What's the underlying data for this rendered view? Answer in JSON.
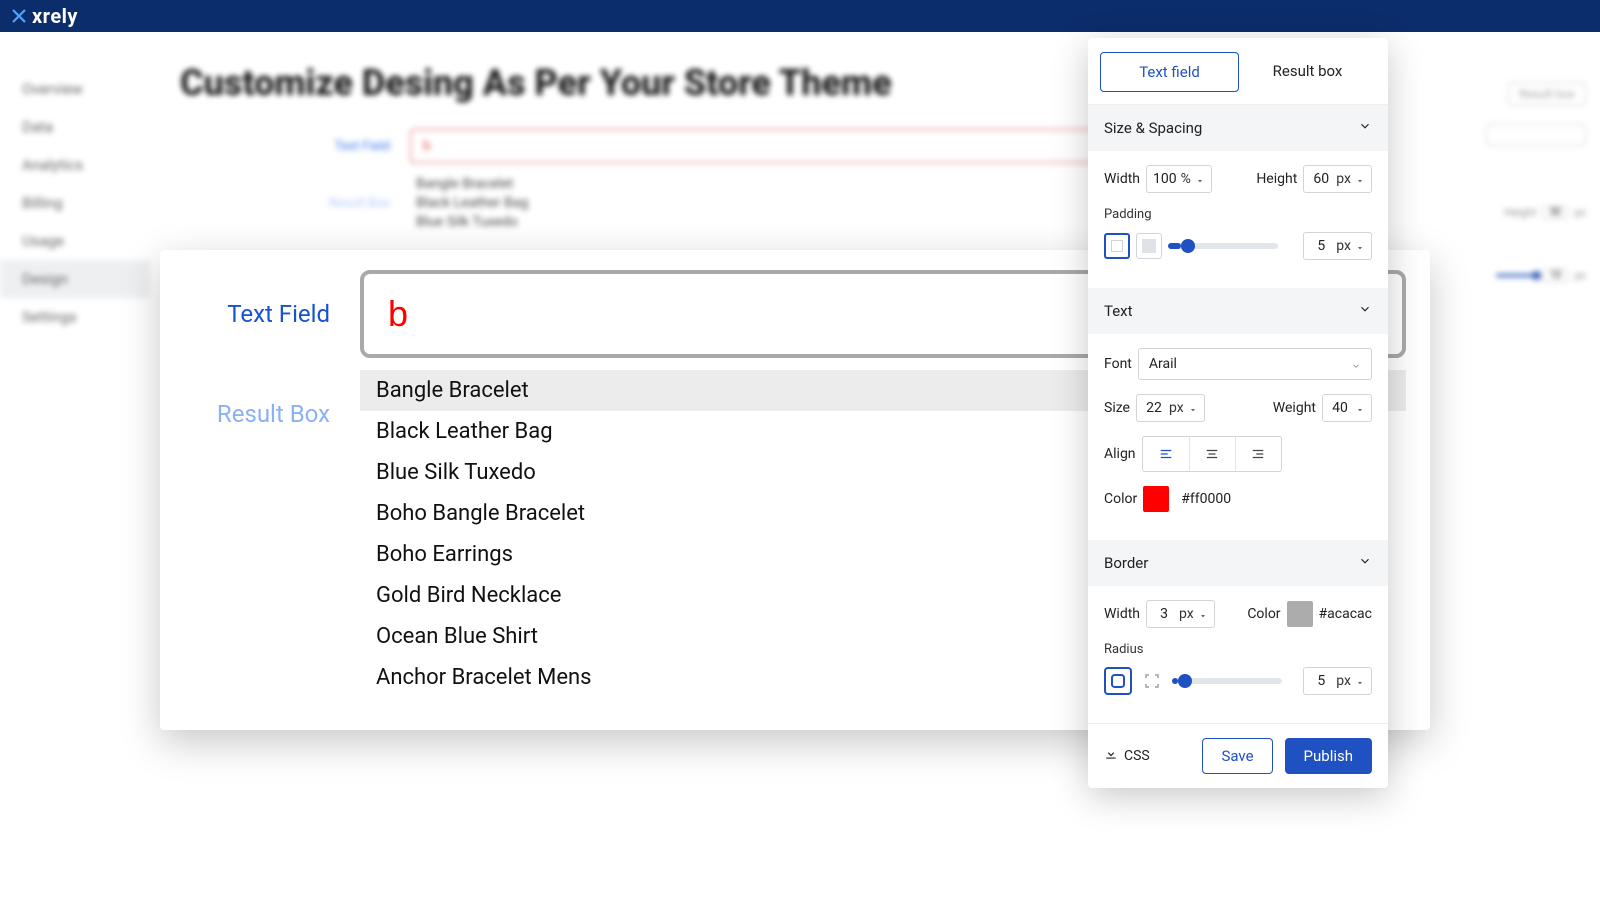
{
  "brand": "xrely",
  "sidebar": {
    "items": [
      "Overview",
      "Data",
      "Analytics",
      "Billing",
      "Usage",
      "Design",
      "Settings"
    ],
    "active_index": 5
  },
  "page_title": "Customize Desing As Per Your Store Theme",
  "back": {
    "labels": {
      "text_field": "Text Field",
      "result_box": "Result Box"
    },
    "search_value": "b",
    "results": [
      "Bangle Bracelet",
      "Black Leather Bag",
      "Blue Silk Tuxedo"
    ],
    "right_tab": "Result box",
    "height_label": "Height",
    "height_value": "50",
    "height_unit": "px",
    "pad_value": "10",
    "pad_unit": "px"
  },
  "preview": {
    "labels": {
      "text_field": "Text Field",
      "result_box": "Result Box"
    },
    "search_value": "b",
    "results": [
      "Bangle Bracelet",
      "Black Leather Bag",
      "Blue Silk Tuxedo",
      "Boho Bangle Bracelet",
      "Boho Earrings",
      "Gold Bird Necklace",
      "Ocean Blue Shirt",
      "Anchor Bracelet Mens"
    ],
    "selected_index": 0
  },
  "panel": {
    "tabs": {
      "text_field": "Text field",
      "result_box": "Result box",
      "active": "text_field"
    },
    "sections": {
      "size_spacing": {
        "title": "Size & Spacing",
        "width_label": "Width",
        "width_value": "100",
        "width_unit": "%",
        "height_label": "Height",
        "height_value": "60",
        "height_unit": "px",
        "padding_label": "Padding",
        "padding_value": "5",
        "padding_unit": "px",
        "padding_slider_pct": 12
      },
      "text": {
        "title": "Text",
        "font_label": "Font",
        "font_value": "Arail",
        "size_label": "Size",
        "size_value": "22",
        "size_unit": "px",
        "weight_label": "Weight",
        "weight_value": "40",
        "align_label": "Align",
        "color_label": "Color",
        "color_value": "#ff0000"
      },
      "border": {
        "title": "Border",
        "width_label": "Width",
        "width_value": "3",
        "width_unit": "px",
        "color_label": "Color",
        "color_value": "#acacac",
        "radius_label": "Radius",
        "radius_value": "5",
        "radius_unit": "px",
        "radius_slider_pct": 5
      }
    },
    "footer": {
      "css": "CSS",
      "save": "Save",
      "publish": "Publish"
    }
  }
}
